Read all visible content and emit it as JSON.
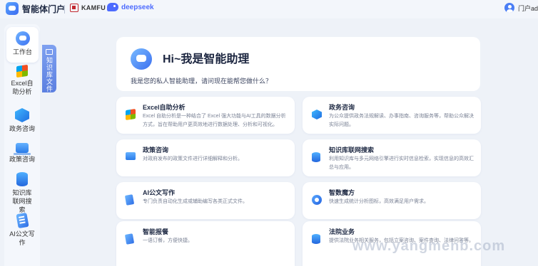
{
  "header": {
    "title": "智能体门户",
    "partner1": "KAMFU",
    "partner2": "deepseek",
    "user_name": "门户admin"
  },
  "sidebar": {
    "items": [
      {
        "label": "工作台",
        "icon": "chat-icon",
        "active": true
      },
      {
        "label": "Excel自助分析",
        "icon": "excel-icon"
      },
      {
        "label": "政务咨询",
        "icon": "cube-icon"
      },
      {
        "label": "政策咨询",
        "icon": "laptop-icon"
      },
      {
        "label": "知识库联网搜索",
        "icon": "database-icon"
      },
      {
        "label": "AI公文写作",
        "icon": "document-icon"
      }
    ]
  },
  "kb_tab": {
    "label": "知识库文件"
  },
  "hero": {
    "title": "Hi~我是智能助理",
    "subtitle": "我是您的私人智能助理，请问现在能帮您做什么？"
  },
  "cards": [
    {
      "title": "Excel自助分析",
      "desc": "Excel 自助分析是一种结合了 Excel 强大功能与AI工具的数据分析方式，旨在帮助用户更高效地进行数据处理、分析和可视化。",
      "icon": "excel-icon"
    },
    {
      "title": "政务咨询",
      "desc": "为公众提供政务法规解读、办事指南、咨询服务等，帮助公众解决实际问题。",
      "icon": "cube-icon"
    },
    {
      "title": "政策咨询",
      "desc": "对政府发布的政策文件进行详细解释和分析。",
      "icon": "laptop-icon"
    },
    {
      "title": "知识库联网搜索",
      "desc": "利用知识库与多元网络引擎进行实时信息检索，实现信息的高效汇总与应用。",
      "icon": "database-icon"
    },
    {
      "title": "AI公文写作",
      "desc": "专门负责自动化生成或辅助编写各类正式文件。",
      "icon": "document-icon"
    },
    {
      "title": "智数魔方",
      "desc": "快速生成统计分析图标，高效满足用户需求。",
      "icon": "magic-cube-icon"
    },
    {
      "title": "智能报餐",
      "desc": "一语订餐，方便快捷。",
      "icon": "phone-icon"
    },
    {
      "title": "法院业务",
      "desc": "提供法院业务相关服务，包括立案咨询、案件查询、法律问答等。",
      "icon": "court-icon"
    }
  ],
  "watermark": "www.yangmenb.com"
}
